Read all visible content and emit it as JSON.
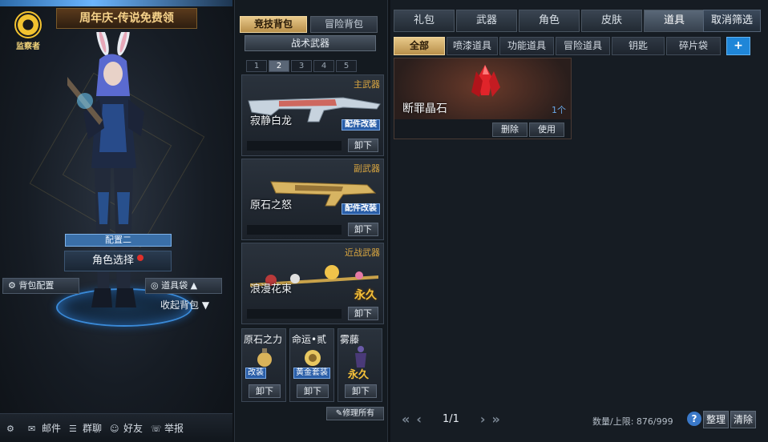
{
  "left": {
    "logo_text": "监察者",
    "promo": "周年庆-传说免费领",
    "preset_label": "配置二",
    "role_select": "角色选择",
    "bag_config": "背包配置",
    "item_bag": "道具袋",
    "fold_bag": "收起背包",
    "bottom_bar": [
      {
        "icon": "gear-icon",
        "label": ""
      },
      {
        "icon": "mail-icon",
        "label": "邮件"
      },
      {
        "icon": "chat-icon",
        "label": "群聊"
      },
      {
        "icon": "friends-icon",
        "label": "好友"
      },
      {
        "icon": "report-icon",
        "label": "举报"
      }
    ]
  },
  "mid": {
    "tabs": [
      {
        "label": "竞技背包",
        "active": true
      },
      {
        "label": "冒险背包",
        "active": false
      }
    ],
    "weapon_set": "战术武器",
    "pages": [
      "1",
      "2",
      "3",
      "4",
      "5"
    ],
    "active_page": "2",
    "slots": [
      {
        "category": "主武器",
        "name": "寂静白龙",
        "badge": "配件改装",
        "button": "卸下"
      },
      {
        "category": "副武器",
        "name": "原石之怒",
        "badge": "配件改装",
        "button": "卸下"
      },
      {
        "category": "近战武器",
        "name": "浪漫花束",
        "badge": "永久",
        "button": "卸下"
      }
    ],
    "small_slots": [
      {
        "name": "原石之力",
        "badge": "改装",
        "button": "卸下"
      },
      {
        "name": "命运•贰",
        "badge": "黄金套装",
        "button": "卸下"
      },
      {
        "name": "雾藤",
        "badge": "永久",
        "button": "卸下"
      }
    ],
    "repair_all": "修理所有"
  },
  "right": {
    "categories": [
      {
        "label": "礼包",
        "active": false
      },
      {
        "label": "武器",
        "active": false
      },
      {
        "label": "角色",
        "active": false
      },
      {
        "label": "皮肤",
        "active": false
      },
      {
        "label": "道具",
        "active": true
      }
    ],
    "cancel_filter": "取消筛选",
    "subtabs": [
      {
        "label": "全部",
        "active": true
      },
      {
        "label": "喷漆道具",
        "active": false
      },
      {
        "label": "功能道具",
        "active": false
      },
      {
        "label": "冒险道具",
        "active": false
      },
      {
        "label": "钥匙",
        "active": false
      },
      {
        "label": "碎片袋",
        "active": false
      }
    ],
    "add_folder": "+",
    "item": {
      "name": "断罪晶石",
      "count": "1个",
      "delete": "删除",
      "use": "使用"
    },
    "pager": {
      "text": "1/1"
    },
    "capacity": "数量/上限: 876/999",
    "help": "?",
    "sort": "整理",
    "clear": "清除"
  },
  "colors": {
    "accent_gold": "#e8c98a",
    "accent_blue": "#1f86d8",
    "permanent_gold": "#f6c23a",
    "category_gold": "#d9a640"
  }
}
